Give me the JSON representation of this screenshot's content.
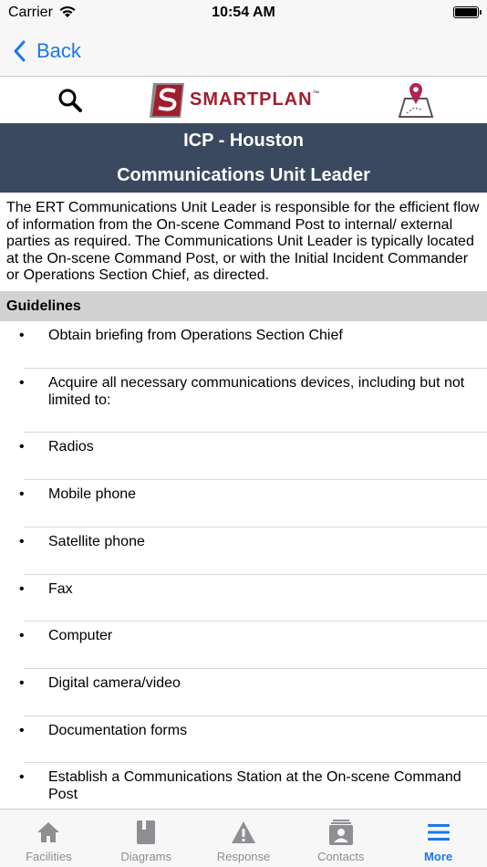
{
  "status_bar": {
    "carrier": "Carrier",
    "time": "10:54 AM",
    "battery_level": 1.0
  },
  "nav": {
    "back_label": "Back"
  },
  "logo": {
    "brand_text": "SMARTPLAN",
    "trademark": "™"
  },
  "header": {
    "site": "ICP - Houston",
    "role": "Communications Unit Leader"
  },
  "description": "The ERT Communications Unit Leader is responsible for the efficient flow of information from the On-scene Command Post to internal/ external parties as required. The Communications Unit Leader is typically located at the On-scene Command Post, or with the Initial Incident Commander or Operations Section Chief, as directed.",
  "guidelines": {
    "title": "Guidelines",
    "items": [
      "Obtain briefing from Operations Section Chief",
      "Acquire all necessary communications devices, including but not limited to:",
      "Radios",
      "Mobile phone",
      "Satellite phone",
      "Fax",
      "Computer",
      "Digital camera/video",
      "Documentation forms",
      "Establish a Communications Station at the On-scene Command Post"
    ]
  },
  "tabs": [
    {
      "label": "Facilities",
      "icon": "home-icon"
    },
    {
      "label": "Diagrams",
      "icon": "book-icon"
    },
    {
      "label": "Response",
      "icon": "warning-icon"
    },
    {
      "label": "Contacts",
      "icon": "contacts-icon"
    },
    {
      "label": "More",
      "icon": "menu-icon"
    }
  ],
  "colors": {
    "accent": "#1a78f0",
    "header_bg": "#3b4960",
    "section_bg": "#d2d2d2",
    "brand_red": "#a11e2d"
  }
}
